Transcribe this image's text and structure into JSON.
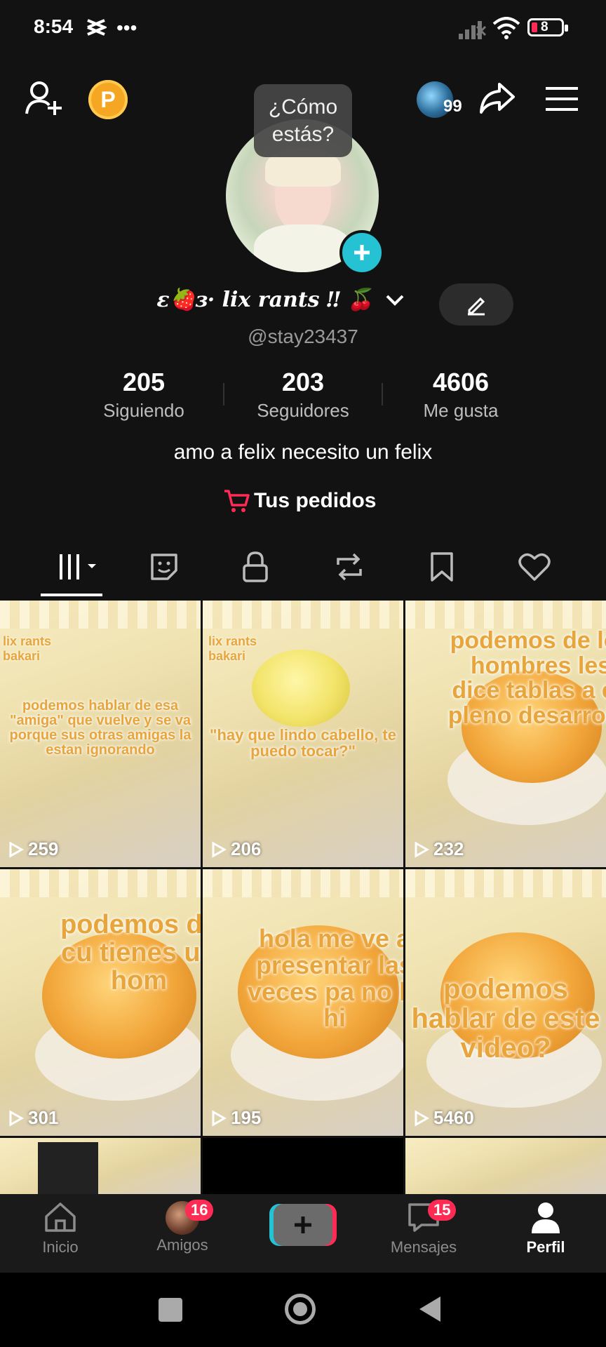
{
  "status": {
    "time": "8:54",
    "battery": "8"
  },
  "header": {
    "coin_label": "P",
    "friends_badge": "99"
  },
  "tooltip": "¿Cómo estás?",
  "profile": {
    "display_name": "ɛ🍓ɜ· 𝒍𝒊𝒙 𝒓𝒂𝒏𝒕𝒔 ‼ 🍒",
    "username": "@stay23437",
    "bio": "amo a felix necesito un felix",
    "orders_label": "Tus pedidos"
  },
  "stats": [
    {
      "value": "205",
      "label": "Siguiendo"
    },
    {
      "value": "203",
      "label": "Seguidores"
    },
    {
      "value": "4606",
      "label": "Me gusta"
    }
  ],
  "videos": [
    {
      "views": "259",
      "caption": "podemos hablar de esa \"amiga\" que vuelve y se va porque sus otras amigas la estan ignorando",
      "tag": "lix rants bakari"
    },
    {
      "views": "206",
      "caption": "\"hay que lindo cabello, te puedo tocar?\"",
      "tag": "lix rants bakari"
    },
    {
      "views": "232",
      "caption": "podemos de los hombres les dice tablas a en pleno desarrollo"
    },
    {
      "views": "301",
      "caption": "podemos de cu tienes un hom"
    },
    {
      "views": "195",
      "caption": "hola me ve a presentar las veces pa no lo hi"
    },
    {
      "views": "5460",
      "caption": "podemos hablar de este video?"
    }
  ],
  "bottom_nav": [
    {
      "label": "Inicio"
    },
    {
      "label": "Amigos",
      "badge": "16"
    },
    {
      "label": ""
    },
    {
      "label": "Mensajes",
      "badge": "15"
    },
    {
      "label": "Perfil"
    }
  ],
  "colors": {
    "accent": "#fe2c55",
    "cyan": "#25c2d4",
    "coin": "#f5a623"
  }
}
